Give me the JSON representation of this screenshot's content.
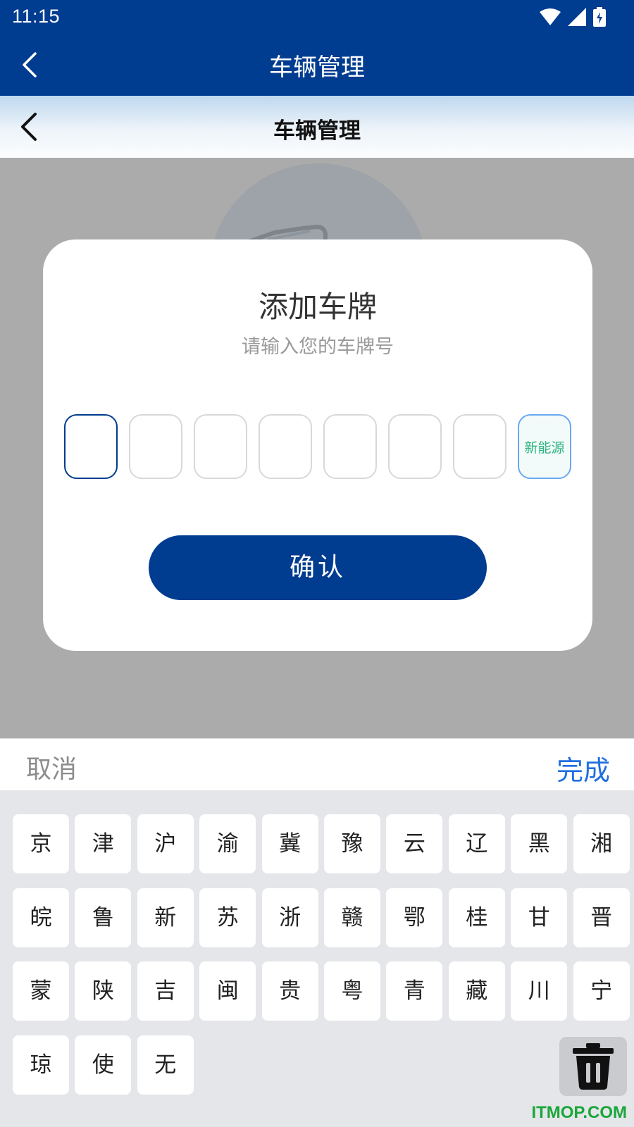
{
  "status_bar": {
    "time": "11:15"
  },
  "app_bar": {
    "title": "车辆管理"
  },
  "web_header": {
    "title": "车辆管理"
  },
  "dialog": {
    "title": "添加车牌",
    "subtitle": "请输入您的车牌号",
    "plate_slots": [
      "",
      "",
      "",
      "",
      "",
      "",
      ""
    ],
    "new_energy_label": "新能源",
    "confirm_label": "确认"
  },
  "keyboard": {
    "cancel_label": "取消",
    "done_label": "完成",
    "rows": [
      [
        "京",
        "津",
        "沪",
        "渝",
        "冀",
        "豫",
        "云",
        "辽",
        "黑",
        "湘"
      ],
      [
        "皖",
        "鲁",
        "新",
        "苏",
        "浙",
        "赣",
        "鄂",
        "桂",
        "甘",
        "晋"
      ],
      [
        "蒙",
        "陕",
        "吉",
        "闽",
        "贵",
        "粤",
        "青",
        "藏",
        "川",
        "宁"
      ],
      [
        "琼",
        "使",
        "无"
      ]
    ],
    "delete_icon": "trash-icon"
  },
  "watermark": "ITMOP.COM",
  "colors": {
    "primary": "#003c8f",
    "done_text": "#1f6fe0",
    "new_energy": "#2bb37e"
  }
}
